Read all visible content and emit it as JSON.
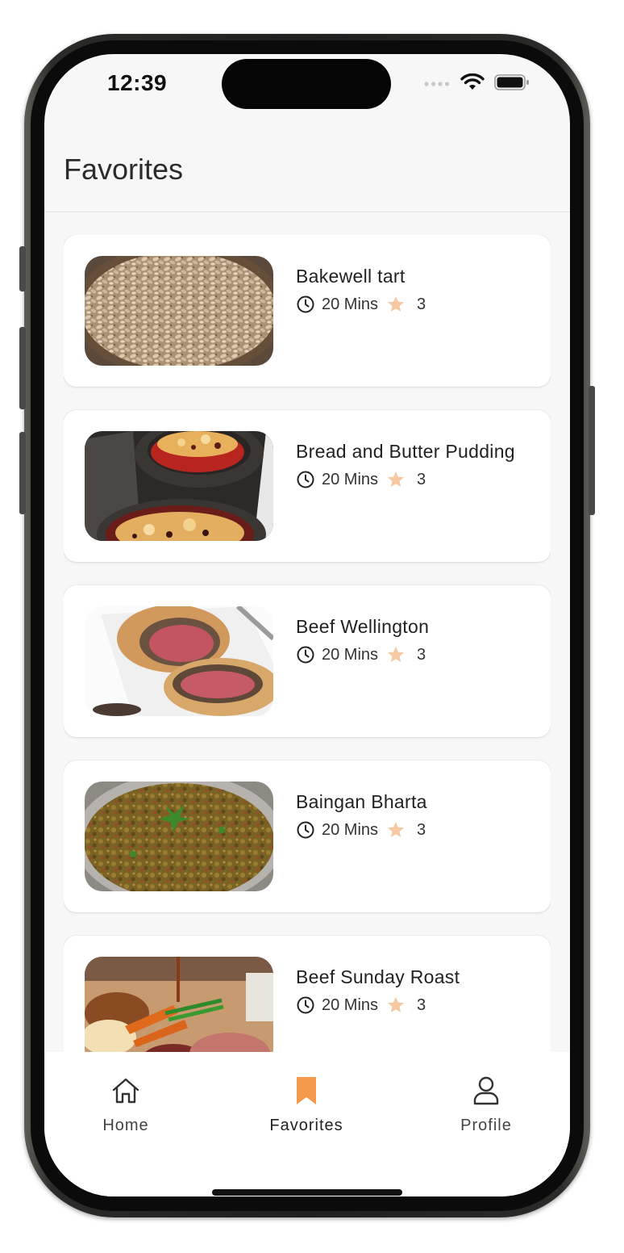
{
  "status_bar": {
    "time": "12:39"
  },
  "app_bar": {
    "title": "Favorites"
  },
  "recipes": [
    {
      "title": "Bakewell tart",
      "time": "20 Mins",
      "rating": "3"
    },
    {
      "title": "Bread and Butter Pudding",
      "time": "20 Mins",
      "rating": "3"
    },
    {
      "title": "Beef Wellington",
      "time": "20 Mins",
      "rating": "3"
    },
    {
      "title": "Baingan Bharta",
      "time": "20 Mins",
      "rating": "3"
    },
    {
      "title": "Beef Sunday Roast",
      "time": "20 Mins",
      "rating": "3"
    }
  ],
  "bottom_nav": {
    "items": [
      {
        "label": "Home",
        "icon": "home-icon",
        "active": false
      },
      {
        "label": "Favorites",
        "icon": "bookmark-icon",
        "active": true
      },
      {
        "label": "Profile",
        "icon": "person-icon",
        "active": false
      }
    ]
  },
  "colors": {
    "accent": "#f39a4d",
    "star": "#f6c9a3",
    "text": "#222222",
    "nav_inactive": "#444444"
  }
}
